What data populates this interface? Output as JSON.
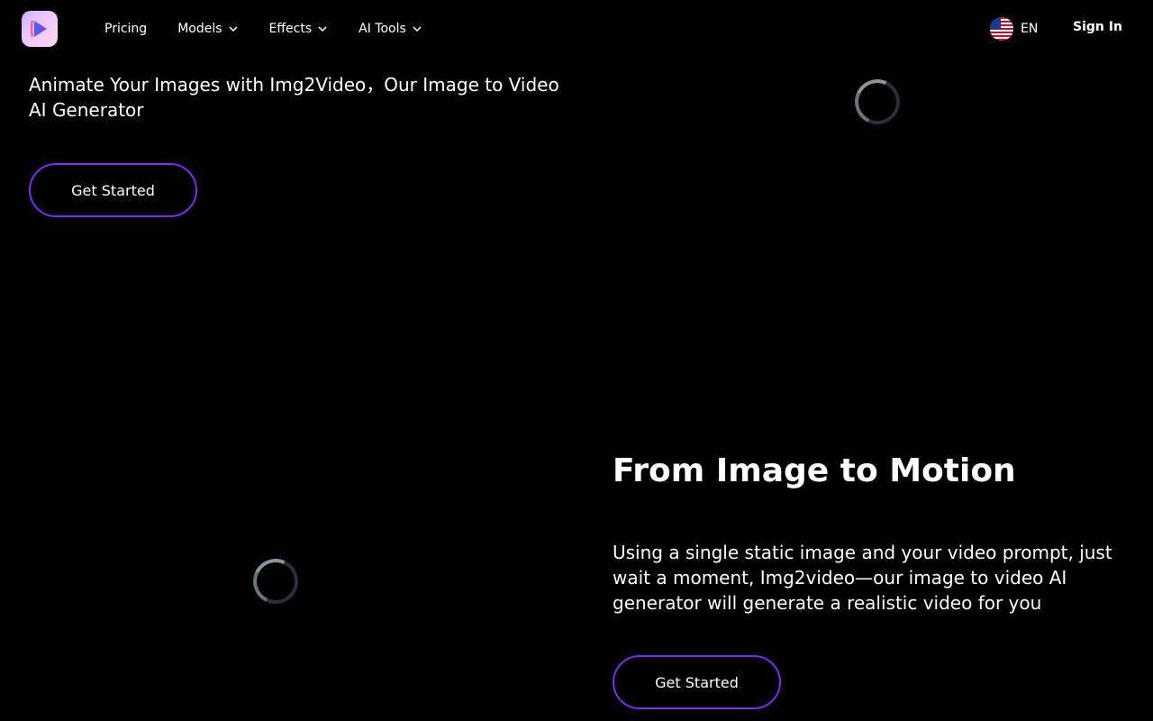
{
  "header": {
    "logo_icon": "play-logo-icon",
    "nav": [
      {
        "label": "Pricing",
        "has_dropdown": false
      },
      {
        "label": "Models",
        "has_dropdown": true
      },
      {
        "label": "Effects",
        "has_dropdown": true
      },
      {
        "label": "AI Tools",
        "has_dropdown": true
      }
    ],
    "language": {
      "label": "EN",
      "icon": "us-flag-icon"
    },
    "signin_label": "Sign In"
  },
  "hero": {
    "text": "Animate Your Images with Img2Video，Our Image to Video AI Generator",
    "cta_label": "Get Started"
  },
  "section2": {
    "title": "From Image to Motion",
    "text": "Using a single static image and your video prompt, just wait a moment, Img2video—our image to video AI generator will generate a realistic video for you",
    "cta_label": "Get Started"
  },
  "colors": {
    "background": "#000000",
    "accent_border": "#7a2cf0",
    "text": "#ffffff"
  }
}
